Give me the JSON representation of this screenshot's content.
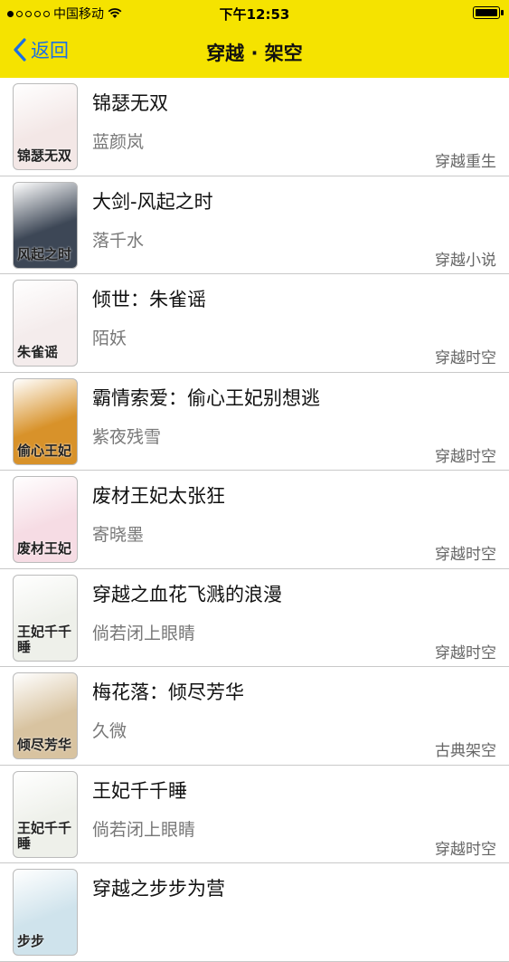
{
  "status_bar": {
    "carrier": "中国移动",
    "time": "下午12:53"
  },
  "nav": {
    "back_label": "返回",
    "title": "穿越 · 架空"
  },
  "books": [
    {
      "title": "锦瑟无双",
      "author": "蓝颜岚",
      "category": "穿越重生",
      "cover_text": "锦瑟无双",
      "cover_color": "#f3e7e6"
    },
    {
      "title": "大剑-风起之时",
      "author": "落千水",
      "category": "穿越小说",
      "cover_text": "风起之时",
      "cover_color": "#3d4756"
    },
    {
      "title": "倾世：朱雀谣",
      "author": "陌妖",
      "category": "穿越时空",
      "cover_text": "朱雀谣",
      "cover_color": "#f4ecec"
    },
    {
      "title": "霸情索爱：偷心王妃别想逃",
      "author": "紫夜残雪",
      "category": "穿越时空",
      "cover_text": "偷心王妃",
      "cover_color": "#d8922a"
    },
    {
      "title": "废材王妃太张狂",
      "author": "寄晓墨",
      "category": "穿越时空",
      "cover_text": "废材王妃",
      "cover_color": "#f6dce4"
    },
    {
      "title": "穿越之血花飞溅的浪漫",
      "author": "倘若闭上眼睛",
      "category": "穿越时空",
      "cover_text": "王妃千千睡",
      "cover_color": "#eef0ea"
    },
    {
      "title": "梅花落：倾尽芳华",
      "author": "久微",
      "category": "古典架空",
      "cover_text": "倾尽芳华",
      "cover_color": "#d8c3a0"
    },
    {
      "title": "王妃千千睡",
      "author": "倘若闭上眼睛",
      "category": "穿越时空",
      "cover_text": "王妃千千睡",
      "cover_color": "#eef0ea"
    },
    {
      "title": "穿越之步步为营",
      "author": "",
      "category": "",
      "cover_text": "步步",
      "cover_color": "#cfe3ec"
    }
  ]
}
